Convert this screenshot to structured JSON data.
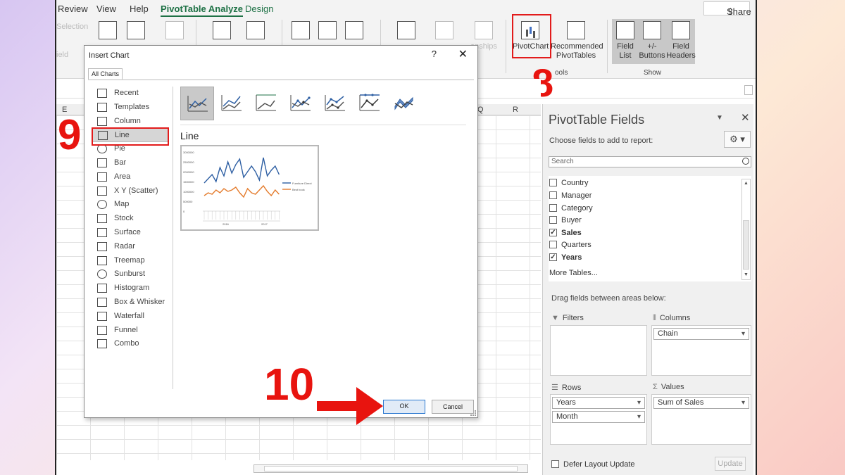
{
  "menubar": {
    "tabs": [
      "Review",
      "View",
      "Help",
      "PivotTable Analyze",
      "Design"
    ],
    "share": "Share"
  },
  "ribbon": {
    "faded_left": [
      "Selection",
      "ield"
    ],
    "buttons": {
      "pivotchart": "PivotChart",
      "recommended_line1": "Recommended",
      "recommended_line2": "PivotTables",
      "field_list_1": "Field",
      "field_list_2": "List",
      "buttons_1": "+/-",
      "buttons_2": "Buttons",
      "headers_1": "Field",
      "headers_2": "Headers",
      "relationships": "onships"
    },
    "groups": {
      "tools": "ools",
      "show": "Show"
    }
  },
  "sheet": {
    "columns": [
      "E",
      "Q",
      "R"
    ]
  },
  "dialog": {
    "title": "Insert Chart",
    "help": "?",
    "close": "✕",
    "tab": "All Charts",
    "chart_types": [
      "Recent",
      "Templates",
      "Column",
      "Line",
      "Pie",
      "Bar",
      "Area",
      "X Y (Scatter)",
      "Map",
      "Stock",
      "Surface",
      "Radar",
      "Treemap",
      "Sunburst",
      "Histogram",
      "Box & Whisker",
      "Waterfall",
      "Funnel",
      "Combo"
    ],
    "selected_type": "Line",
    "subtype_title": "Line",
    "preview": {
      "yticks": [
        "3000000",
        "2500000",
        "2000000",
        "1500000",
        "1000000",
        "500000",
        "0"
      ],
      "legend": [
        "Furniture Direct",
        "Best book"
      ],
      "years": [
        "2016",
        "2017"
      ],
      "series_colors": [
        "#2e5fa3",
        "#e47b2c"
      ]
    },
    "ok": "OK",
    "cancel": "Cancel"
  },
  "pane": {
    "title": "PivotTable Fields",
    "choose": "Choose fields to add to report:",
    "search_placeholder": "Search",
    "fields": [
      {
        "name": "Country",
        "checked": false
      },
      {
        "name": "Manager",
        "checked": false
      },
      {
        "name": "Category",
        "checked": false
      },
      {
        "name": "Buyer",
        "checked": false
      },
      {
        "name": "Sales",
        "checked": true
      },
      {
        "name": "Quarters",
        "checked": false
      },
      {
        "name": "Years",
        "checked": true
      }
    ],
    "more_tables": "More Tables...",
    "drag_label": "Drag fields between areas below:",
    "areas": {
      "filters": "Filters",
      "columns": "Columns",
      "rows": "Rows",
      "values": "Values"
    },
    "columns_fields": [
      "Chain"
    ],
    "rows_fields": [
      "Years",
      "Month"
    ],
    "values_fields": [
      "Sum of Sales"
    ],
    "defer": "Defer Layout Update",
    "update": "Update"
  },
  "annotations": {
    "step8": "8",
    "step9": "9",
    "step10": "10"
  },
  "colors": {
    "accent_green": "#1e7145",
    "annotation_red": "#e8140f",
    "ok_blue": "#2b78d0"
  }
}
